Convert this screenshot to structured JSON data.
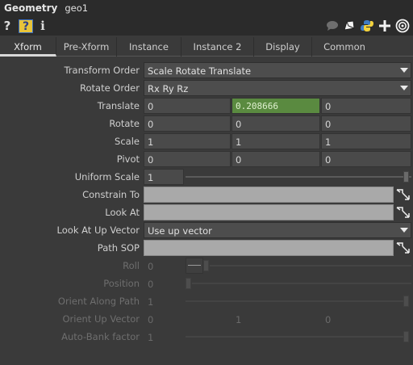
{
  "title": {
    "type": "Geometry",
    "name": "geo1"
  },
  "toolbar": {
    "help": "?",
    "help_box": "?",
    "info": "i"
  },
  "tabs": [
    "Xform",
    "Pre-Xform",
    "Instance",
    "Instance 2",
    "Display",
    "Common"
  ],
  "params": {
    "transform_order": {
      "label": "Transform Order",
      "value": "Scale Rotate Translate"
    },
    "rotate_order": {
      "label": "Rotate Order",
      "value": "Rx Ry Rz"
    },
    "translate": {
      "label": "Translate",
      "values": [
        "0",
        "0.208666",
        "0"
      ]
    },
    "rotate": {
      "label": "Rotate",
      "values": [
        "0",
        "0",
        "0"
      ]
    },
    "scale": {
      "label": "Scale",
      "values": [
        "1",
        "1",
        "1"
      ]
    },
    "pivot": {
      "label": "Pivot",
      "values": [
        "0",
        "0",
        "0"
      ]
    },
    "uniform_scale": {
      "label": "Uniform Scale",
      "value": "1"
    },
    "constrain_to": {
      "label": "Constrain To",
      "value": ""
    },
    "look_at": {
      "label": "Look At",
      "value": ""
    },
    "look_at_up": {
      "label": "Look At Up Vector",
      "value": "Use up vector"
    },
    "path_sop": {
      "label": "Path SOP",
      "value": ""
    },
    "roll": {
      "label": "Roll",
      "value": "0"
    },
    "position": {
      "label": "Position",
      "value": "0"
    },
    "orient_along_path": {
      "label": "Orient Along Path",
      "value": "1"
    },
    "orient_up_vector": {
      "label": "Orient Up Vector",
      "values": [
        "0",
        "1",
        "0"
      ]
    },
    "auto_bank": {
      "label": "Auto-Bank factor",
      "value": "1"
    }
  },
  "colors": {
    "highlight": "#5a8a40",
    "background": "#3a3a3a",
    "accent": "#e8c43a"
  }
}
